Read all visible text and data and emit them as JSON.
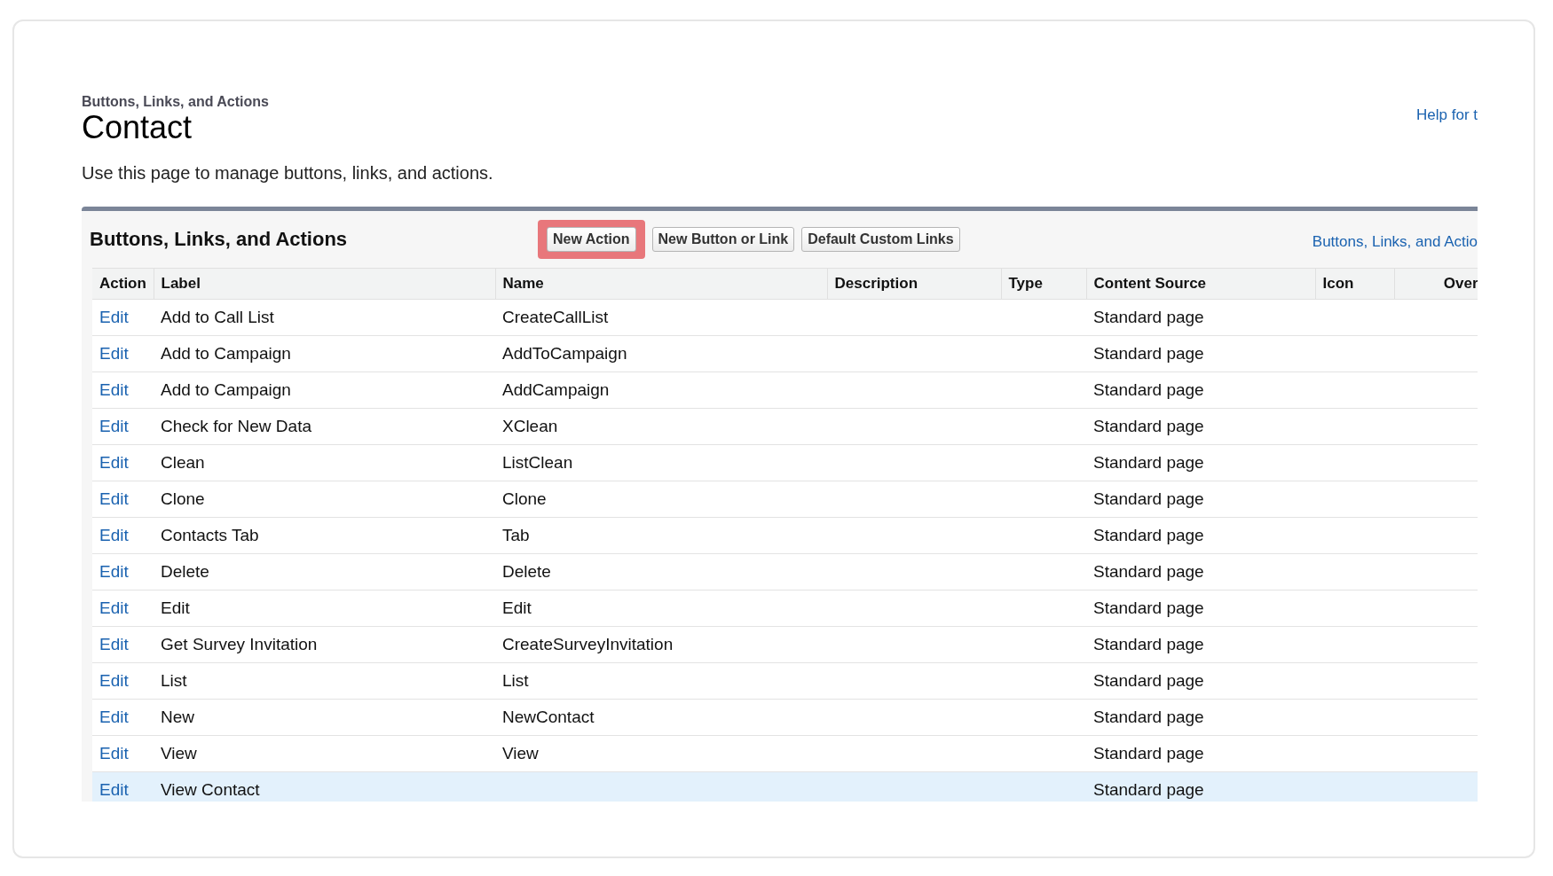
{
  "breadcrumb": "Buttons, Links, and Actions",
  "title": "Contact",
  "help_link": "Help for t",
  "description": "Use this page to manage buttons, links, and actions.",
  "panel": {
    "title": "Buttons, Links, and Actions",
    "buttons": [
      {
        "label": "New Action",
        "highlighted": true
      },
      {
        "label": "New Button or Link",
        "highlighted": false
      },
      {
        "label": "Default Custom Links",
        "highlighted": false
      }
    ],
    "link": "Buttons, Links, and Actio"
  },
  "table": {
    "columns": [
      "Action",
      "Label",
      "Name",
      "Description",
      "Type",
      "Content Source",
      "Icon",
      "Over"
    ],
    "rows": [
      {
        "action": "Edit",
        "label": "Add to Call List",
        "name": "CreateCallList",
        "content_source": "Standard page",
        "highlighted": false
      },
      {
        "action": "Edit",
        "label": "Add to Campaign",
        "name": "AddToCampaign",
        "content_source": "Standard page",
        "highlighted": false
      },
      {
        "action": "Edit",
        "label": "Add to Campaign",
        "name": "AddCampaign",
        "content_source": "Standard page",
        "highlighted": false
      },
      {
        "action": "Edit",
        "label": "Check for New Data",
        "name": "XClean",
        "content_source": "Standard page",
        "highlighted": false
      },
      {
        "action": "Edit",
        "label": "Clean",
        "name": "ListClean",
        "content_source": "Standard page",
        "highlighted": false
      },
      {
        "action": "Edit",
        "label": "Clone",
        "name": "Clone",
        "content_source": "Standard page",
        "highlighted": false
      },
      {
        "action": "Edit",
        "label": "Contacts Tab",
        "name": "Tab",
        "content_source": "Standard page",
        "highlighted": false
      },
      {
        "action": "Edit",
        "label": "Delete",
        "name": "Delete",
        "content_source": "Standard page",
        "highlighted": false
      },
      {
        "action": "Edit",
        "label": "Edit",
        "name": "Edit",
        "content_source": "Standard page",
        "highlighted": false
      },
      {
        "action": "Edit",
        "label": "Get Survey Invitation",
        "name": "CreateSurveyInvitation",
        "content_source": "Standard page",
        "highlighted": false
      },
      {
        "action": "Edit",
        "label": "List",
        "name": "List",
        "content_source": "Standard page",
        "highlighted": false
      },
      {
        "action": "Edit",
        "label": "New",
        "name": "NewContact",
        "content_source": "Standard page",
        "highlighted": false
      },
      {
        "action": "Edit",
        "label": "View",
        "name": "View",
        "content_source": "Standard page",
        "highlighted": false
      },
      {
        "action": "Edit",
        "label": "View Contact",
        "content_source": "Standard page",
        "highlighted": true
      }
    ]
  }
}
